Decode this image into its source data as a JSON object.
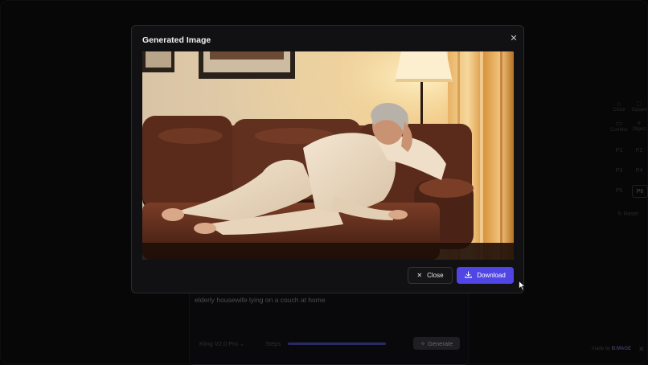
{
  "colors": {
    "accent": "#4f46e5",
    "modal_bg": "#111113",
    "page_bg": "#0b0b0d"
  },
  "modal": {
    "title": "Generated Image",
    "close_icon": "close-icon",
    "image_alt": "elderly housewife lying on a couch at home",
    "buttons": {
      "close_label": "Close",
      "close_icon": "x-icon",
      "download_label": "Download",
      "download_icon": "download-icon"
    }
  },
  "background": {
    "prompt_text": "elderly housewife lying on a couch at home",
    "model_label": "Kling V2.0 Pro",
    "steps_label": "Steps",
    "steps_progress": 1.0,
    "generate_label": "Generate",
    "made_by_text": "made by",
    "made_by_brand": "B:MAGE",
    "side_tools": [
      {
        "label": "Circle",
        "icon": "circle-icon"
      },
      {
        "label": "Square",
        "icon": "square-icon"
      },
      {
        "label": "Corridor",
        "icon": "corridor-icon"
      },
      {
        "label": "Object",
        "icon": "plus-icon"
      }
    ],
    "pages": [
      "P1",
      "P2",
      "P3",
      "P4",
      "P5",
      "P6"
    ],
    "active_page": "P6",
    "reset_label": "Reset"
  }
}
